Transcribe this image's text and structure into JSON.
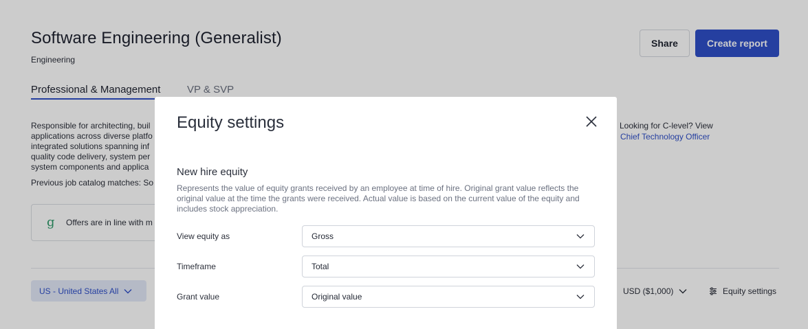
{
  "page": {
    "title": "Software Engineering (Generalist)",
    "subtitle": "Engineering",
    "share_label": "Share",
    "create_report_label": "Create report",
    "tabs": [
      {
        "label": "Professional & Management"
      },
      {
        "label": "VP & SVP"
      }
    ],
    "description": "Responsible for architecting, buil applications across diverse platfo integrated solutions spanning inf quality code delivery, system per system components and applica",
    "previous_matches": "Previous job catalog matches: So",
    "offers_text": "Offers are in line with m",
    "offers_icon": "g",
    "clevel_text": "Looking for C-level? View",
    "clevel_link": "Chief Technology Officer",
    "region_label": "US - United States All",
    "currency_label": "USD ($1,000)",
    "equity_settings_label": "Equity settings"
  },
  "modal": {
    "title": "Equity settings",
    "section_title": "New hire equity",
    "section_desc": "Represents the value of equity grants received by an employee at time of hire. Original grant value reflects the original value at the time the grants were received. Actual value is based on the current value of the equity and includes stock appreciation.",
    "rows": [
      {
        "label": "View equity as",
        "value": "Gross"
      },
      {
        "label": "Timeframe",
        "value": "Total"
      },
      {
        "label": "Grant value",
        "value": "Original value"
      }
    ]
  },
  "colors": {
    "accent": "#2f4fc9",
    "overlay": "rgba(0,0,0,0.2)",
    "logo_green": "#2e9a6a"
  }
}
